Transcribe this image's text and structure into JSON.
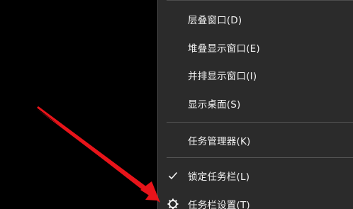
{
  "menu": {
    "items": [
      {
        "label": "层叠窗口(D)"
      },
      {
        "label": "堆叠显示窗口(E)"
      },
      {
        "label": "并排显示窗口(I)"
      },
      {
        "label": "显示桌面(S)"
      },
      {
        "label": "任务管理器(K)"
      },
      {
        "label": "锁定任务栏(L)",
        "checked": true,
        "icon": "checkmark-icon"
      },
      {
        "label": "任务栏设置(T)",
        "icon": "gear-icon"
      }
    ]
  },
  "annotation": {
    "arrow_color": "#e8141a",
    "target": "任务栏设置(T)"
  },
  "colors": {
    "desktop_background": "#000000",
    "menu_background": "#2b2b2b",
    "menu_text": "#f2f2f2",
    "separator": "#555555"
  }
}
